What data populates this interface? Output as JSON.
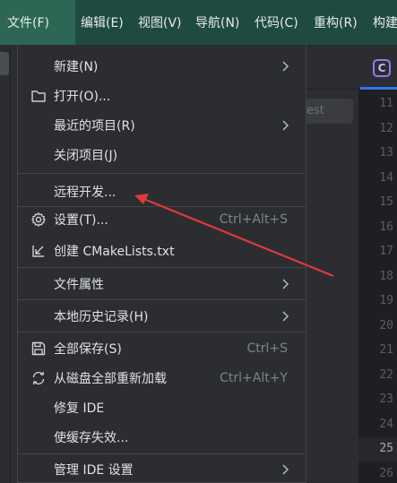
{
  "menubar": {
    "items": [
      {
        "label": "文件(F)"
      },
      {
        "label": "编辑(E)"
      },
      {
        "label": "视图(V)"
      },
      {
        "label": "导航(N)"
      },
      {
        "label": "代码(C)"
      },
      {
        "label": "重构(R)"
      },
      {
        "label": "构建"
      }
    ]
  },
  "menu": {
    "new": "新建(N)",
    "open": "打开(O)...",
    "recent": "最近的项目(R)",
    "close": "关闭项目(J)",
    "remote": "远程开发...",
    "settings": "设置(T)...",
    "settings_shortcut": "Ctrl+Alt+S",
    "cmake": "创建 CMakeLists.txt",
    "file_props": "文件属性",
    "local_history": "本地历史记录(H)",
    "save_all": "全部保存(S)",
    "save_all_shortcut": "Ctrl+S",
    "reload": "从磁盘全部重新加载",
    "reload_shortcut": "Ctrl+Alt+Y",
    "repair": "修复 IDE",
    "invalidate": "使缓存失效...",
    "manage_ide": "管理 IDE 设置"
  },
  "editor": {
    "tab_icon_letter": "C",
    "ghost_text": "est",
    "line_numbers": [
      "11",
      "12",
      "13",
      "14",
      "15",
      "16",
      "17",
      "18",
      "19",
      "20",
      "21",
      "22",
      "23",
      "24",
      "25",
      "26"
    ],
    "current_line": "25"
  },
  "colors": {
    "menubar_bg": "#1f4a3f",
    "menu_bg": "#2b2d30",
    "annotation_arrow": "#e0393e"
  }
}
